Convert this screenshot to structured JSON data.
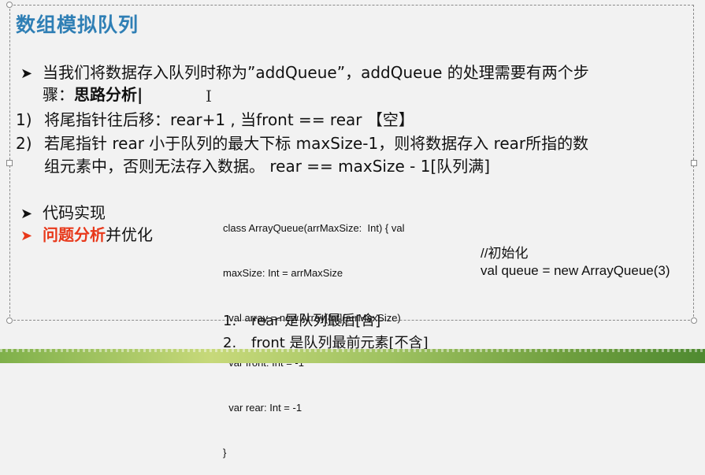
{
  "slide": {
    "title": "数组模拟队列",
    "bullet1": {
      "line1": "当我们将数据存入队列时称为”addQueue”，addQueue 的处理需要有两个步",
      "line2_prefix": "骤：",
      "line2_bold": "思路分析|"
    },
    "step1": {
      "num": "1)",
      "text": "将尾指针往后移：rear+1 , 当front == rear 【空】"
    },
    "step2": {
      "num": "2)",
      "line1": "若尾指针 rear 小于队列的最大下标 maxSize-1，则将数据存入 rear所指的数",
      "line2": "组元素中，否则无法存入数据。 rear  == maxSize - 1[队列满]"
    },
    "bullet2": {
      "text": "代码实现"
    },
    "bullet3": {
      "red": "问题分析",
      "rest": "并优化"
    },
    "code": {
      "lines": [
        "class ArrayQueue(arrMaxSize:  Int) { val",
        "maxSize: Int = arrMaxSize",
        "  val array = new Array[Int](arrMaxSize)",
        "  var front: Int = -1",
        "  var rear: Int = -1",
        "}"
      ]
    },
    "init": {
      "comment": "//初始化",
      "statement": "val queue = new ArrayQueue(3)"
    },
    "notes": [
      {
        "num": "1.",
        "text": "rear 是队列最后[含]"
      },
      {
        "num": "2.",
        "text": "front 是队列最前元素[不含]"
      }
    ],
    "bullet_glyph": "➤",
    "cursor_glyph": "I"
  },
  "colors": {
    "title": "#2f7fb5",
    "highlight": "#e8381a"
  }
}
